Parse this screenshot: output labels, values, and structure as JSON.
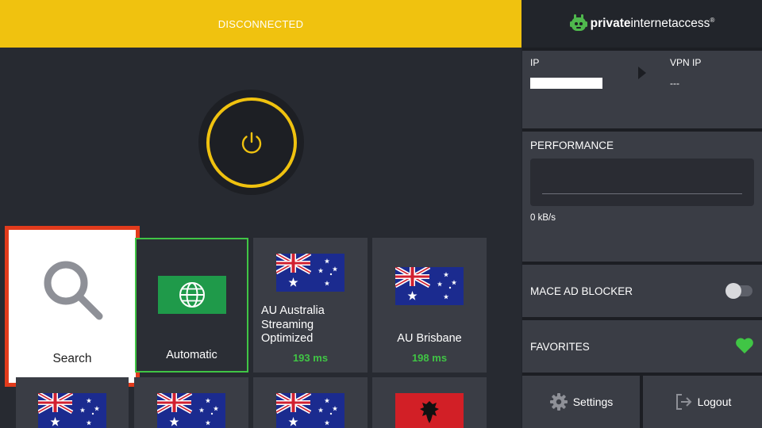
{
  "status": {
    "text": "DISCONNECTED"
  },
  "search_tile": {
    "label": "Search"
  },
  "servers": [
    {
      "name": "Automatic",
      "ping": "",
      "flag": "globe"
    },
    {
      "name_lines": [
        "AU Australia",
        "Streaming",
        "Optimized"
      ],
      "ping": "193 ms",
      "flag": "australia"
    },
    {
      "name": "AU Brisbane",
      "ping": "198 ms",
      "flag": "australia"
    },
    {
      "flag": "australia"
    },
    {
      "flag": "australia"
    },
    {
      "flag": "australia"
    },
    {
      "flag": "albania"
    }
  ],
  "logo": {
    "bold": "private",
    "normal": "internetaccess",
    "mark": "®"
  },
  "ip_panel": {
    "ip_label": "IP",
    "vpn_ip_label": "VPN IP",
    "vpn_ip_value": "---"
  },
  "performance": {
    "title": "PERFORMANCE",
    "speed": "0 kB/s"
  },
  "mace": {
    "label": "MACE AD BLOCKER",
    "enabled": false
  },
  "favorites": {
    "label": "FAVORITES"
  },
  "footer": {
    "settings_label": "Settings",
    "logout_label": "Logout"
  },
  "colors": {
    "accent_yellow": "#f0c20f",
    "green": "#40c545",
    "highlight_red": "#e23b1c"
  }
}
